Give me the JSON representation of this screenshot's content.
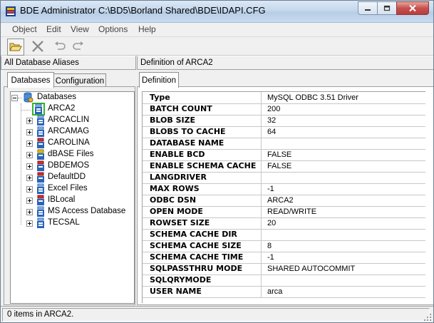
{
  "window": {
    "title": "BDE Administrator  C:\\BD5\\Borland Shared\\BDE\\IDAPI.CFG"
  },
  "menu": [
    "Object",
    "Edit",
    "View",
    "Options",
    "Help"
  ],
  "toolbar": {
    "icons": [
      "open-folder-icon",
      "delete-x-icon",
      "undo-icon",
      "redo-icon"
    ]
  },
  "left_header": "All Database Aliases",
  "right_header": "Definition of ARCA2",
  "left_tabs": [
    "Databases",
    "Configuration"
  ],
  "right_tabs": [
    "Definition"
  ],
  "tree": {
    "root": "Databases",
    "items": [
      {
        "label": "ARCA2",
        "selected": true,
        "expandable": false
      },
      {
        "label": "ARCACLIN",
        "expandable": true
      },
      {
        "label": "ARCAMAG",
        "expandable": true
      },
      {
        "label": "CAROLINA",
        "expandable": true
      },
      {
        "label": "dBASE Files",
        "expandable": true
      },
      {
        "label": "DBDEMOS",
        "expandable": true
      },
      {
        "label": "DefaultDD",
        "expandable": true
      },
      {
        "label": "Excel Files",
        "expandable": true
      },
      {
        "label": "IBLocal",
        "expandable": true
      },
      {
        "label": "MS Access Database",
        "expandable": true
      },
      {
        "label": "TECSAL",
        "expandable": true
      }
    ]
  },
  "definition": [
    {
      "key": "Type",
      "value": "MySQL ODBC 3.51 Driver"
    },
    {
      "key": "BATCH COUNT",
      "value": "200"
    },
    {
      "key": "BLOB SIZE",
      "value": "32"
    },
    {
      "key": "BLOBS TO CACHE",
      "value": "64"
    },
    {
      "key": "DATABASE NAME",
      "value": ""
    },
    {
      "key": "ENABLE BCD",
      "value": "FALSE"
    },
    {
      "key": "ENABLE SCHEMA CACHE",
      "value": "FALSE"
    },
    {
      "key": "LANGDRIVER",
      "value": ""
    },
    {
      "key": "MAX ROWS",
      "value": "-1"
    },
    {
      "key": "ODBC DSN",
      "value": "ARCA2"
    },
    {
      "key": "OPEN MODE",
      "value": "READ/WRITE"
    },
    {
      "key": "ROWSET SIZE",
      "value": "20"
    },
    {
      "key": "SCHEMA CACHE DIR",
      "value": ""
    },
    {
      "key": "SCHEMA CACHE SIZE",
      "value": "8"
    },
    {
      "key": "SCHEMA CACHE TIME",
      "value": "-1"
    },
    {
      "key": "SQLPASSTHRU MODE",
      "value": "SHARED AUTOCOMMIT"
    },
    {
      "key": "SQLQRYMODE",
      "value": ""
    },
    {
      "key": "USER NAME",
      "value": "arca"
    }
  ],
  "status": "0 items in ARCA2.",
  "colors": {
    "selection_border": "#2fb52f",
    "db_icon_blue": "#2a64b8"
  }
}
